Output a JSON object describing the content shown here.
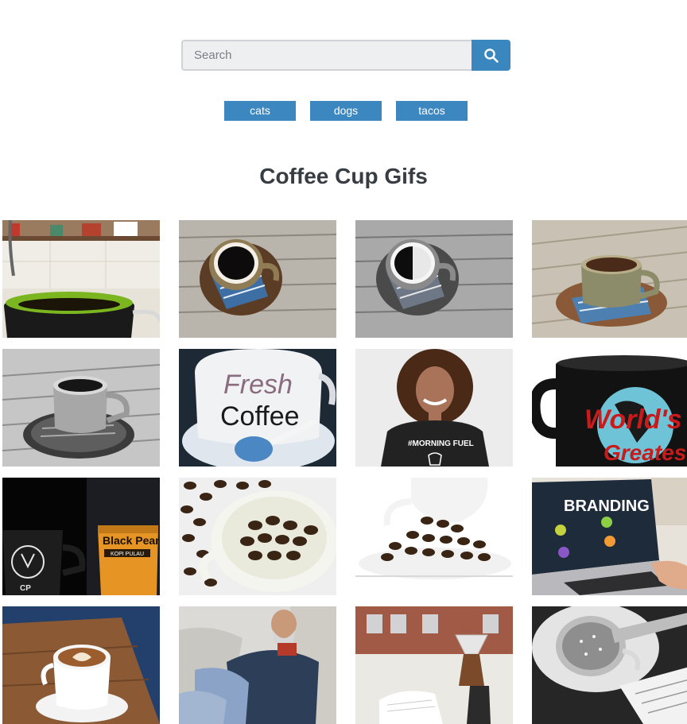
{
  "search": {
    "placeholder": "Search"
  },
  "chips": [
    {
      "label": "cats"
    },
    {
      "label": "dogs"
    },
    {
      "label": "tacos"
    }
  ],
  "page_title": "Coffee Cup Gifs",
  "gifs": [
    {
      "icon": "kitchen-mug"
    },
    {
      "icon": "mug-on-wood"
    },
    {
      "icon": "mug-on-wood-gray"
    },
    {
      "icon": "mug-on-wood-warm"
    },
    {
      "icon": "cup-on-table-bw"
    },
    {
      "icon": "fresh-coffee-cup",
      "text": [
        "Fresh",
        "Coffee"
      ]
    },
    {
      "icon": "woman-in-tshirt",
      "text": [
        "#MORNING FUEL"
      ]
    },
    {
      "icon": "worlds-greatest-mug",
      "text": [
        "World's",
        "Greatest"
      ]
    },
    {
      "icon": "mug-and-coffee-bag",
      "text": [
        "Black Pearl",
        "KOPI PULAU",
        "CP"
      ]
    },
    {
      "icon": "cup-of-beans"
    },
    {
      "icon": "spilled-beans"
    },
    {
      "icon": "branding-laptop",
      "text": [
        "BRANDING"
      ]
    },
    {
      "icon": "latte-art"
    },
    {
      "icon": "man-sleeping"
    },
    {
      "icon": "pour-over"
    },
    {
      "icon": "cup-and-notebook"
    }
  ]
}
